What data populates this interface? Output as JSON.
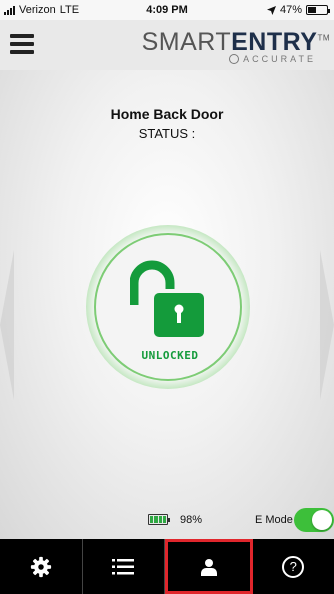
{
  "status_bar": {
    "carrier": "Verizon",
    "network": "LTE",
    "time": "4:09 PM",
    "battery_percent": "47%",
    "battery_level": 0.47
  },
  "header": {
    "brand_light": "SMART",
    "brand_bold": "ENTRY",
    "brand_tm": "TM",
    "brand_sub": "ACCURATE"
  },
  "main": {
    "door_name": "Home Back Door",
    "status_label": "STATUS :",
    "lock_status": "UNLOCKED"
  },
  "info": {
    "battery_percent": "98%",
    "emode_label": "E Mode",
    "emode_on": true
  },
  "tabs": [
    {
      "icon": "gear-icon"
    },
    {
      "icon": "list-icon"
    },
    {
      "icon": "user-icon",
      "active": true
    },
    {
      "icon": "help-icon"
    }
  ],
  "colors": {
    "accent_green": "#149b3b",
    "toggle_green": "#3dbf3a",
    "active_tab_border": "#e0262c"
  }
}
